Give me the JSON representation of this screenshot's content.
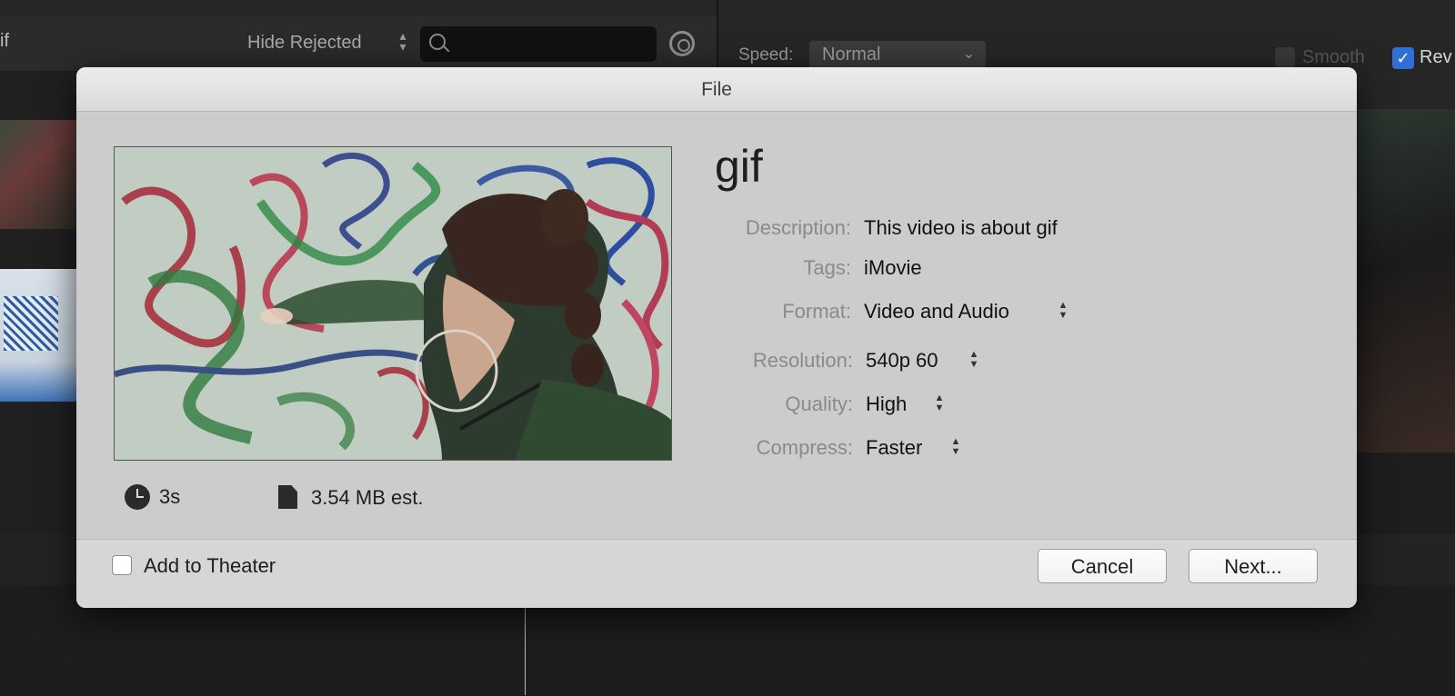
{
  "background": {
    "left_title": "if",
    "filter_label": "Hide Rejected",
    "speed_label": "Speed:",
    "speed_value": "Normal",
    "smooth_label": "Smooth",
    "reverse_label": "Rev"
  },
  "dialog": {
    "title": "File",
    "share_title": "gif",
    "duration": "3s",
    "file_size": "3.54 MB est.",
    "properties": {
      "description": {
        "label": "Description:",
        "value": "This video is about gif"
      },
      "tags": {
        "label": "Tags:",
        "value": "iMovie"
      },
      "format": {
        "label": "Format:",
        "value": "Video and Audio"
      },
      "resolution": {
        "label": "Resolution:",
        "value": "540p 60"
      },
      "quality": {
        "label": "Quality:",
        "value": "High"
      },
      "compress": {
        "label": "Compress:",
        "value": "Faster"
      }
    },
    "add_to_theater": {
      "label": "Add to Theater",
      "checked": false
    },
    "cancel_label": "Cancel",
    "next_label": "Next..."
  },
  "icons": [
    "search-icon",
    "gear-icon",
    "clock-icon",
    "document-icon",
    "stepper-icon",
    "chevron-down-icon",
    "checkmark-icon"
  ],
  "colors": {
    "app_background": "#1e1e1e",
    "dialog_background": "#d0d0d0",
    "accent_blue": "#2f6fd6"
  }
}
